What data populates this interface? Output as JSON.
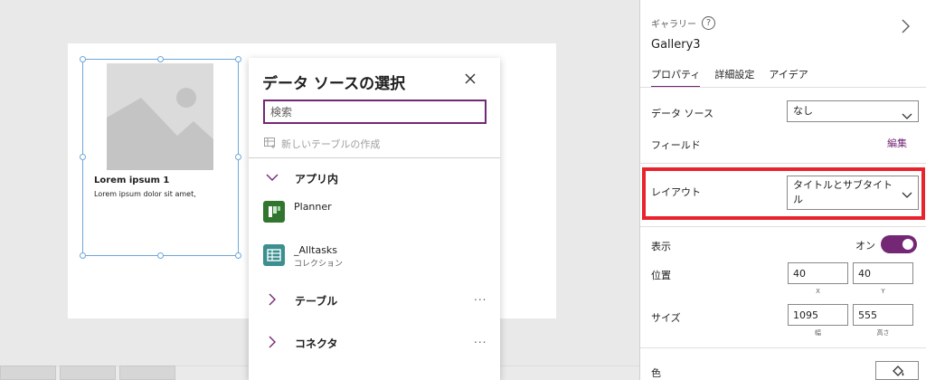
{
  "gallery_item": {
    "title": "Lorem ipsum 1",
    "subtitle": "Lorem ipsum dolor sit amet,"
  },
  "data_source_panel": {
    "title": "データ ソースの選択",
    "search_placeholder": "検索",
    "new_table_label": "新しいテーブルの作成",
    "sections": [
      {
        "label": "アプリ内",
        "expanded": true
      },
      {
        "label": "テーブル",
        "expanded": false,
        "more": "..."
      },
      {
        "label": "コネクタ",
        "expanded": false,
        "more": "..."
      }
    ],
    "items": [
      {
        "name": "Planner",
        "desc": "",
        "icon": "planner-icon",
        "color": "#31752f"
      },
      {
        "name": "_Alltasks",
        "desc": "コレクション",
        "icon": "collection-icon",
        "color": "#3b8f8f"
      }
    ]
  },
  "properties_pane": {
    "control_type": "ギャラリー",
    "help_glyph": "?",
    "control_name": "Gallery3",
    "tabs": [
      "プロパティ",
      "詳細設定",
      "アイデア"
    ],
    "active_tab": "プロパティ",
    "data_source_label": "データ ソース",
    "data_source_value": "なし",
    "fields_label": "フィールド",
    "fields_edit": "編集",
    "layout_label": "レイアウト",
    "layout_value": "タイトルとサブタイトル",
    "visible_label": "表示",
    "visible_state": "オン",
    "position_label": "位置",
    "position_x": "40",
    "position_y": "40",
    "x_caption": "X",
    "y_caption": "Y",
    "size_label": "サイズ",
    "size_width": "1095",
    "size_height": "555",
    "width_caption": "幅",
    "height_caption": "高さ",
    "color_label": "色"
  },
  "colors": {
    "accent": "#742774",
    "highlight": "#e8232d",
    "selection": "#6ea7da"
  }
}
